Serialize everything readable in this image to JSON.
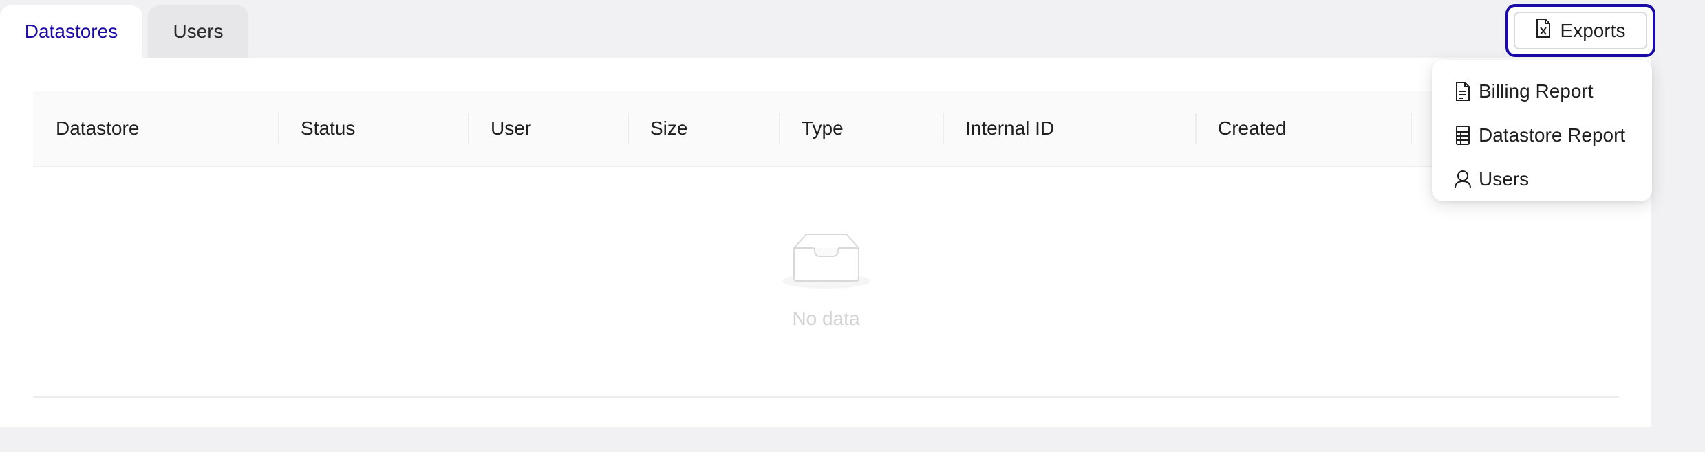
{
  "tabs": [
    {
      "label": "Datastores",
      "active": true
    },
    {
      "label": "Users",
      "active": false
    }
  ],
  "exports": {
    "label": "Exports",
    "icon": "file-excel-icon"
  },
  "dropdown": {
    "items": [
      {
        "label": "Billing Report",
        "icon": "file-text-icon"
      },
      {
        "label": "Datastore Report",
        "icon": "table-icon"
      },
      {
        "label": "Users",
        "icon": "user-icon"
      }
    ]
  },
  "table": {
    "columns": [
      "Datastore",
      "Status",
      "User",
      "Size",
      "Type",
      "Internal ID",
      "Created"
    ],
    "empty_text": "No data"
  },
  "colors": {
    "accent": "#1a0aa6",
    "background": "#f1f1f4",
    "panel": "#ffffff"
  }
}
